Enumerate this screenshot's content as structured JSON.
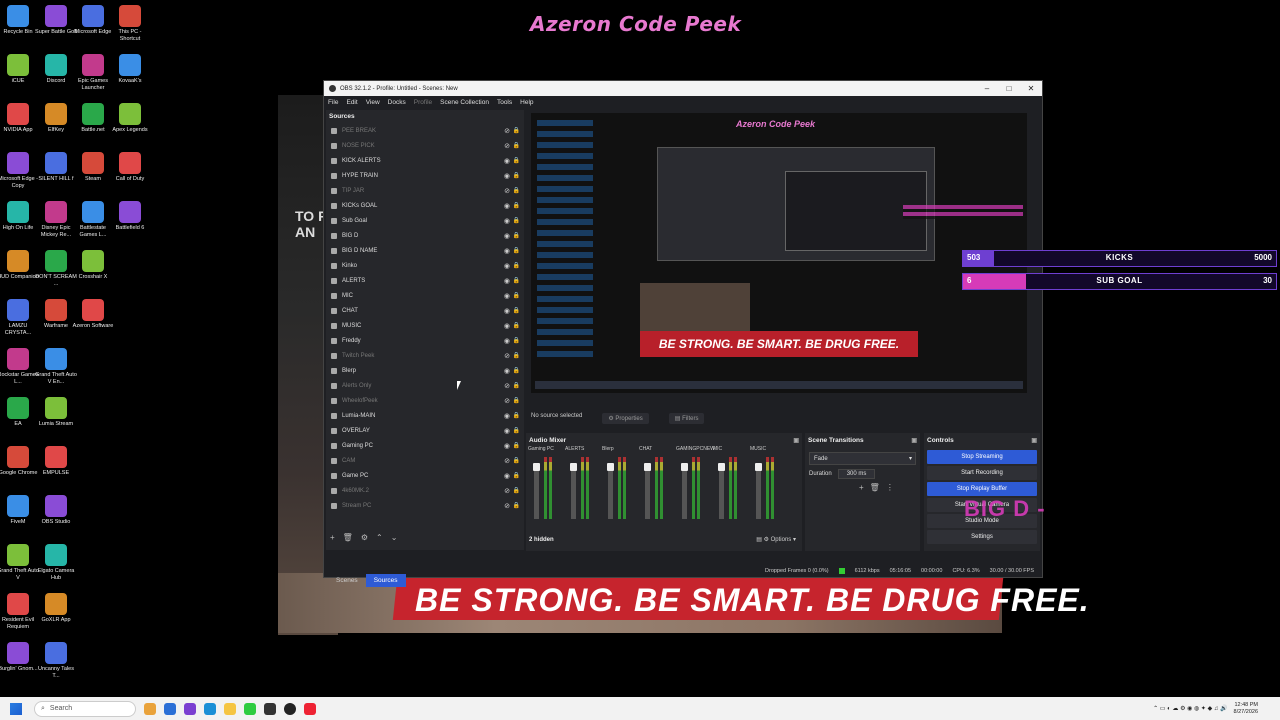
{
  "stream_title": "Azeron Code Peek",
  "desktop": {
    "col1": [
      "Recycle Bin",
      "iCUE",
      "NVIDIA App",
      "Microsoft Edge - Copy",
      "High On Life",
      "HUD Companion",
      "LAMZU CRYSTA...",
      "Rockstar Games L...",
      "EA",
      "Google Chrome",
      "FiveM",
      "Grand Theft Auto V",
      "Resident Evil Requiem",
      "Burglin' Gnom..."
    ],
    "col2": [
      "Super Battle Golf",
      "Discord",
      "ElfKey",
      "SILENT HILL f",
      "Disney Epic Mickey Re...",
      "DON'T SCREAM ...",
      "Warframe",
      "Grand Theft Auto V En...",
      "Lumia Stream",
      "EMPULSE",
      "OBS Studio",
      "Elgato Camera Hub",
      "GoXLR App",
      "Uncanny Tales T..."
    ],
    "col3": [
      "Microsoft Edge",
      "Epic Games Launcher",
      "Battle.net",
      "Steam",
      "Battlestate Games L...",
      "Crosshair X",
      "Azeron Software"
    ],
    "col4": [
      "This PC - Shortcut",
      "KovaaK's",
      "Apex Legends",
      "Call of Duty",
      "Battlefield 6"
    ]
  },
  "bg_text": "TO R\nAN",
  "banner_text": "BE STRONG. BE SMART. BE DRUG FREE.",
  "obs": {
    "title": "OBS 32.1.2 - Profile: Untitled - Scenes: New",
    "menu": [
      "File",
      "Edit",
      "View",
      "Docks",
      "Profile",
      "Scene Collection",
      "Tools",
      "Help"
    ],
    "sources_title": "Sources",
    "sources": [
      {
        "name": "PEE BREAK",
        "dim": true
      },
      {
        "name": "NOSE PICK",
        "dim": true
      },
      {
        "name": "KICK ALERTS",
        "dim": false
      },
      {
        "name": "HYPE TRAIN",
        "dim": false
      },
      {
        "name": "TIP JAR",
        "dim": true
      },
      {
        "name": "KICKs GOAL",
        "dim": false
      },
      {
        "name": "Sub Goal",
        "dim": false
      },
      {
        "name": "BIG D",
        "dim": false
      },
      {
        "name": "BIG D NAME",
        "dim": false
      },
      {
        "name": "Kinko",
        "dim": false
      },
      {
        "name": "ALERTS",
        "dim": false
      },
      {
        "name": "MIC",
        "dim": false
      },
      {
        "name": "CHAT",
        "dim": false
      },
      {
        "name": "MUSIC",
        "dim": false
      },
      {
        "name": "Freddy",
        "dim": false
      },
      {
        "name": "Twitch Peek",
        "dim": true
      },
      {
        "name": "Blerp",
        "dim": false
      },
      {
        "name": "Alerts Only",
        "dim": true
      },
      {
        "name": "WheelofPeek",
        "dim": true
      },
      {
        "name": "Lumia-MAIN",
        "dim": false
      },
      {
        "name": "OVERLAY",
        "dim": false
      },
      {
        "name": "Gaming PC",
        "dim": false
      },
      {
        "name": "CAM",
        "dim": true
      },
      {
        "name": "Game PC",
        "dim": false
      },
      {
        "name": "4k60MK.2",
        "dim": true
      },
      {
        "name": "Stream PC",
        "dim": true
      }
    ],
    "dock_tabs": [
      "Scenes",
      "Sources"
    ],
    "preview_title": "Azeron Code Peek",
    "preview_banner": "BE STRONG. BE SMART. BE DRUG FREE.",
    "no_source": "No source selected",
    "properties": "Properties",
    "filters": "Filters",
    "audio_mixer": {
      "title": "Audio Mixer",
      "channels": [
        "Gaming PC",
        "ALERTS",
        "Blerp",
        "CHAT",
        "GAMINGPCNEW",
        "MIC",
        "MUSIC"
      ],
      "hidden": "2 hidden",
      "options": "Options"
    },
    "transitions": {
      "title": "Scene Transitions",
      "selected": "Fade",
      "duration_label": "Duration",
      "duration": "300 ms"
    },
    "controls": {
      "title": "Controls",
      "buttons": [
        "Stop Streaming",
        "Start Recording",
        "Stop Replay Buffer",
        "Start Virtual Camera",
        "Studio Mode",
        "Settings"
      ]
    },
    "status": {
      "dropped": "Dropped Frames 0 (0.0%)",
      "kbps": "6112 kbps",
      "live": "05:16:05",
      "rec": "00:00:00",
      "cpu": "CPU: 6.3%",
      "fps": "30.00 / 30.00 FPS"
    }
  },
  "overlay_tag": "BIG D -",
  "widgets": [
    {
      "left": "503",
      "label": "KICKS",
      "right": "5000",
      "progress": 0.1006,
      "color": "#6e3fd1"
    },
    {
      "left": "6",
      "label": "SUB GOAL",
      "right": "30",
      "progress": 0.2,
      "color": "#d63bb8"
    }
  ],
  "taskbar": {
    "search": "Search",
    "time": "12:48 PM",
    "date": "8/27/2026"
  }
}
